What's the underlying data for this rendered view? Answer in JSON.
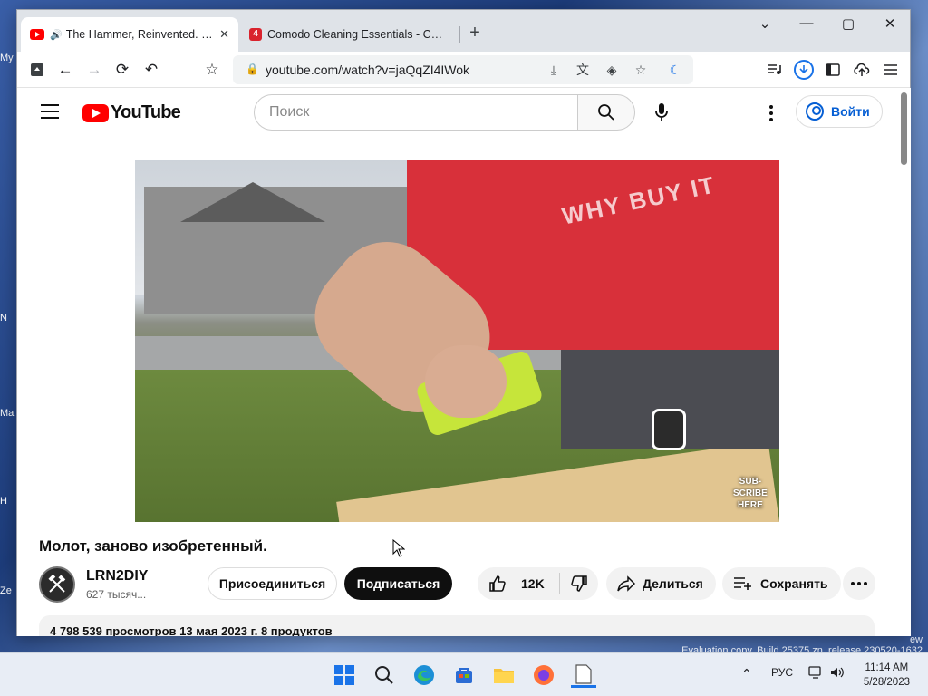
{
  "desktop": {
    "icon_labels": [
      "My",
      "N",
      "Ma",
      "H",
      "Ze"
    ]
  },
  "browser": {
    "tabs": [
      {
        "title": "The Hammer, Reinvented. - You",
        "active": true,
        "audio": true
      },
      {
        "title": "Comodo Cleaning Essentials - Скачать",
        "active": false,
        "favicon_letter": "4"
      }
    ],
    "new_tab_label": "+",
    "window_controls": {
      "collapse": "⌄",
      "minimize": "—",
      "maximize": "▢",
      "close": "✕"
    },
    "url": "youtube.com/watch?v=jaQqZI4IWok",
    "nav": {
      "back": "←",
      "forward": "→",
      "reload": "⟳",
      "undo": "↶"
    }
  },
  "youtube": {
    "logo_text": "YouTube",
    "search_placeholder": "Поиск",
    "signin_label": "Войти",
    "video": {
      "title": "Молот, заново изобретенный.",
      "shirt_text": "WHY BUY IT",
      "overlay_text": "SUB-\nSCRIBE\nHERE"
    },
    "channel": {
      "name": "LRN2DIY",
      "subscribers": "627 тысяч..."
    },
    "buttons": {
      "join": "Присоединиться",
      "subscribe": "Подписаться",
      "like_count": "12K",
      "share": "Делиться",
      "save": "Сохранять"
    },
    "description_line": "4 798 539 просмотров 13 мая 2023 г. 8 продуктов"
  },
  "watermark": {
    "line1": "ew",
    "line2": "Evaluation copy. Build 25375.zn_release.230520-1632"
  },
  "taskbar": {
    "language": "РУС",
    "time": "11:14 AM",
    "date": "5/28/2023"
  },
  "colors": {
    "youtube_red": "#ff0000",
    "link_blue": "#065fd4",
    "subscribe_bg": "#0f0f0f"
  }
}
